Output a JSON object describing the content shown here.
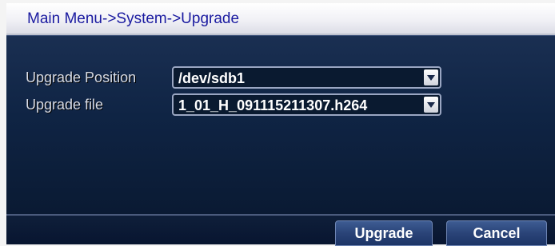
{
  "window": {
    "title": "Main Menu->System->Upgrade"
  },
  "form": {
    "upgrade_position": {
      "label": "Upgrade Position",
      "value": "/dev/sdb1"
    },
    "upgrade_file": {
      "label": "Upgrade file",
      "value": "1_01_H_091115211307.h264"
    }
  },
  "buttons": {
    "upgrade_label": "Upgrade",
    "cancel_label": "Cancel"
  },
  "icons": {
    "dropdown": "chevron-down-icon"
  },
  "colors": {
    "title_text": "#1a1aa0",
    "panel_background": "#0f2444",
    "button_background": "#2a4478"
  }
}
